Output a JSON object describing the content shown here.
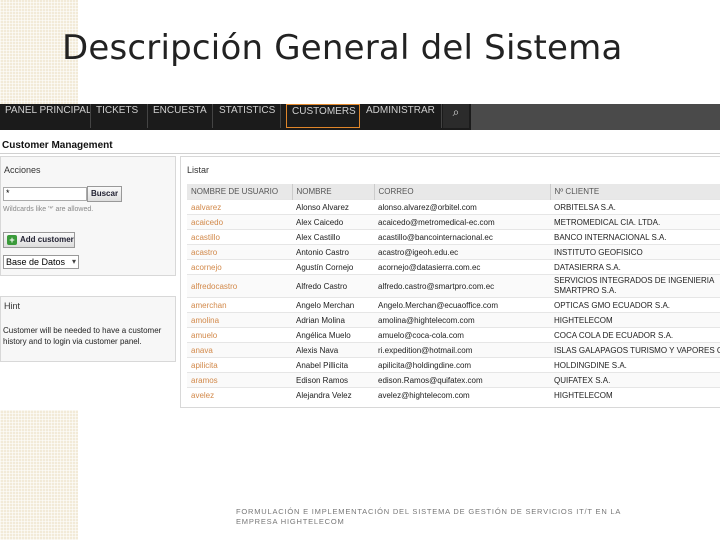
{
  "slide": {
    "title": "Descripción General del Sistema",
    "footer": "FORMULACIÓN E IMPLEMENTACIÓN DEL SISTEMA DE GESTIÓN DE SERVICIOS IT/T EN LA EMPRESA HIGHTELECOM"
  },
  "nav": {
    "items": [
      "PANEL PRINCIPAL",
      "TICKETS",
      "ENCUESTA",
      "STATISTICS",
      "CUSTOMERS",
      "ADMINISTRAR"
    ],
    "active": "CUSTOMERS",
    "search_icon": "search-icon"
  },
  "page": {
    "title": "Customer Management"
  },
  "actions": {
    "heading": "Acciones",
    "search_value": "*",
    "search_button": "Buscar",
    "wildcards_note": "Wildcards like '*' are allowed.",
    "add_button": "Add customer",
    "select_value": "Base de Datos"
  },
  "hint": {
    "heading": "Hint",
    "text": "Customer will be needed to have a customer history and to login via customer panel."
  },
  "list": {
    "heading": "Listar",
    "columns": [
      "NOMBRE DE USUARIO",
      "NOMBRE",
      "CORREO",
      "Nº CLIENTE"
    ],
    "rows": [
      [
        "aalvarez",
        "Alonso Alvarez",
        "alonso.alvarez@orbitel.com",
        "ORBITELSA S.A."
      ],
      [
        "acaicedo",
        "Alex Caicedo",
        "acaicedo@metromedical-ec.com",
        "METROMEDICAL CIA. LTDA."
      ],
      [
        "acastillo",
        "Alex Castillo",
        "acastillo@bancointernacional.ec",
        "BANCO INTERNACIONAL S.A."
      ],
      [
        "acastro",
        "Antonio Castro",
        "acastro@igeoh.edu.ec",
        "INSTITUTO GEOFISICO"
      ],
      [
        "acornejo",
        "Agustín Cornejo",
        "acornejo@datasierra.com.ec",
        "DATASIERRA S.A."
      ],
      [
        "alfredocastro",
        "Alfredo Castro",
        "alfredo.castro@smartpro.com.ec",
        "SERVICIOS INTEGRADOS DE INGENIERIA SMARTPRO S.A."
      ],
      [
        "amerchan",
        "Angelo Merchan",
        "Angelo.Merchan@ecuaoffice.com",
        "OPTICAS GMO ECUADOR S.A."
      ],
      [
        "amolina",
        "Adrian Molina",
        "amolina@hightelecom.com",
        "HIGHTELECOM"
      ],
      [
        "amuelo",
        "Angélica Muelo",
        "amuelo@coca-cola.com",
        "COCA COLA DE ECUADOR S.A."
      ],
      [
        "anava",
        "Alexis Nava",
        "ri.expedition@hotmail.com",
        "ISLAS GALAPAGOS TURISMO Y VAPORES CA"
      ],
      [
        "apilicita",
        "Anabel Pillicita",
        "apilicita@holdingdine.com",
        "HOLDINGDINE S.A."
      ],
      [
        "aramos",
        "Edison Ramos",
        "edison.Ramos@quifatex.com",
        "QUIFATEX S.A."
      ],
      [
        "avelez",
        "Alejandra Velez",
        "avelez@hightelecom.com",
        "HIGHTELECOM"
      ]
    ]
  }
}
